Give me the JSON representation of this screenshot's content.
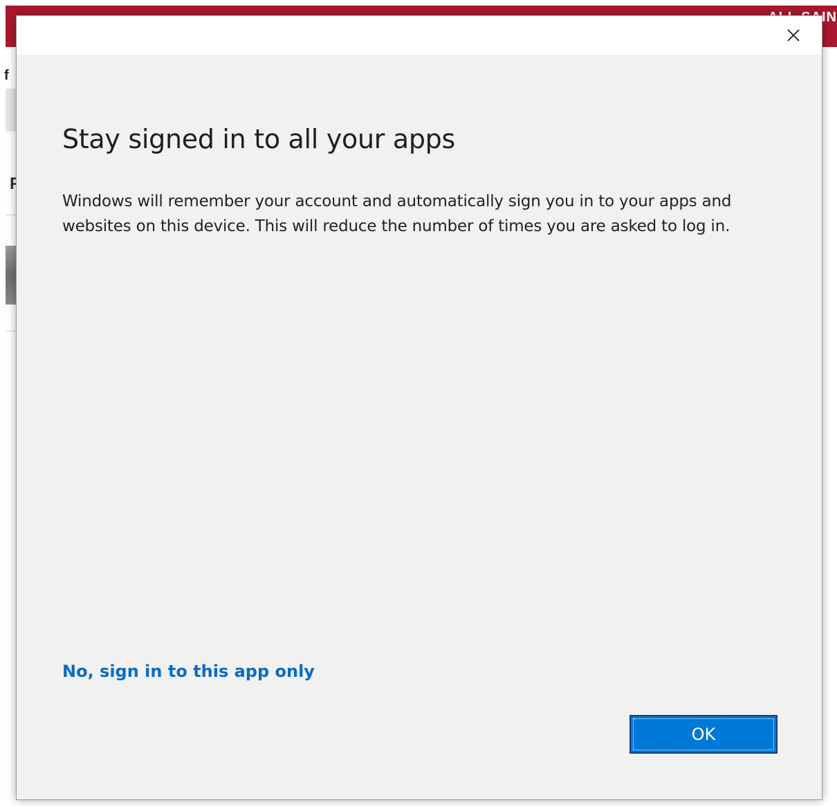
{
  "background_app": {
    "header_text": "ALL SAIN",
    "fragment_f": "f",
    "fragment_r": "F",
    "header_color": "#a8192e"
  },
  "dialog": {
    "close_icon": "close-icon",
    "title": "Stay signed in to all your apps",
    "body": "Windows will remember your account and automatically sign you in to your apps and websites on this device. This will reduce the number of times you are asked to log in.",
    "secondary_link": "No, sign in to this app only",
    "primary_button": "OK",
    "accent_color": "#0078d7",
    "link_color": "#0a6cc2"
  }
}
